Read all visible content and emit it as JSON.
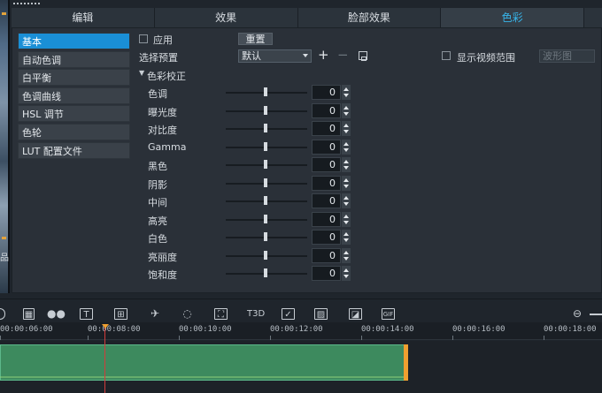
{
  "tabs": [
    "编辑",
    "效果",
    "脸部效果",
    "色彩"
  ],
  "active_tab": 3,
  "sidebar": [
    "基本",
    "自动色调",
    "白平衡",
    "色调曲线",
    "HSL 调节",
    "色轮",
    "LUT 配置文件"
  ],
  "apply_label": "应用",
  "reset_label": "重置",
  "preset_label": "选择预置",
  "preset_value": "默认",
  "show_video_range_label": "显示视频范围",
  "range_placeholder": "波形图",
  "section_title": "色彩校正",
  "adjustments": [
    {
      "name": "色调",
      "value": "0"
    },
    {
      "name": "曝光度",
      "value": "0"
    },
    {
      "name": "对比度",
      "value": "0"
    },
    {
      "name": "Gamma",
      "value": "0"
    },
    {
      "name": "黑色",
      "value": "0"
    },
    {
      "name": "阴影",
      "value": "0"
    },
    {
      "name": "中间",
      "value": "0"
    },
    {
      "name": "高亮",
      "value": "0"
    },
    {
      "name": "白色",
      "value": "0"
    },
    {
      "name": "亮丽度",
      "value": "0"
    },
    {
      "name": "饱和度",
      "value": "0"
    }
  ],
  "timeline": {
    "ticks": [
      "00:00:06:00",
      "00:00:08:00",
      "00:00:10:00",
      "00:00:12:00",
      "00:00:14:00",
      "00:00:16:00",
      "00:00:18:00"
    ]
  },
  "colors": {
    "accent": "#37b5ea",
    "selected": "#1a8fd6",
    "clip": "#3d8a5e",
    "playhead": "#d23b3b"
  },
  "left_strip_char": "品"
}
